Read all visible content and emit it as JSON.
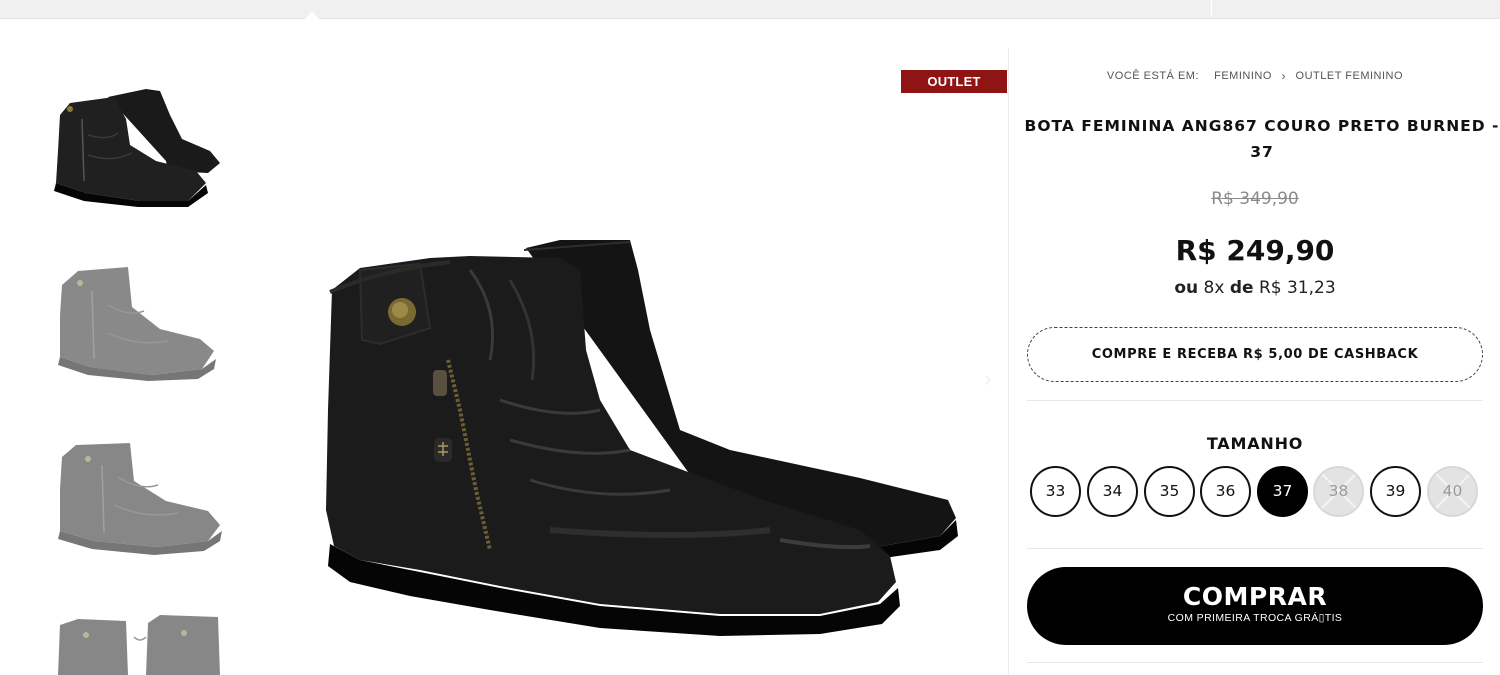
{
  "badge": {
    "outlet": "OUTLET"
  },
  "breadcrumb": {
    "prefix": "VOCÊ ESTÁ EM:",
    "items": [
      "FEMININO",
      "OUTLET FEMININO"
    ]
  },
  "product": {
    "title": "BOTA FEMININA ANG867 COURO PRETO BURNED - 37",
    "old_price": "R$ 349,90",
    "price": "R$ 249,90",
    "installments": {
      "prefix": "ou",
      "count": "8x",
      "mid": "de",
      "amount": "R$ 31,23"
    },
    "cashback": "COMPRE E RECEBA R$ 5,00 DE CASHBACK"
  },
  "size_selector": {
    "label": "TAMANHO",
    "options": [
      {
        "value": "33",
        "state": "available"
      },
      {
        "value": "34",
        "state": "available"
      },
      {
        "value": "35",
        "state": "available"
      },
      {
        "value": "36",
        "state": "available"
      },
      {
        "value": "37",
        "state": "selected"
      },
      {
        "value": "38",
        "state": "unavailable"
      },
      {
        "value": "39",
        "state": "available"
      },
      {
        "value": "40",
        "state": "unavailable"
      }
    ]
  },
  "buy_button": {
    "label": "COMPRAR",
    "sublabel": "COM PRIMEIRA TROCA GRÁ▯TIS"
  },
  "icons": {
    "breadcrumb_separator": "chevron-right-icon",
    "gallery_next": "chevron-right-icon"
  },
  "colors": {
    "outlet_badge": "#8f1515",
    "primary_button": "#000000",
    "selected_size": "#000000"
  }
}
